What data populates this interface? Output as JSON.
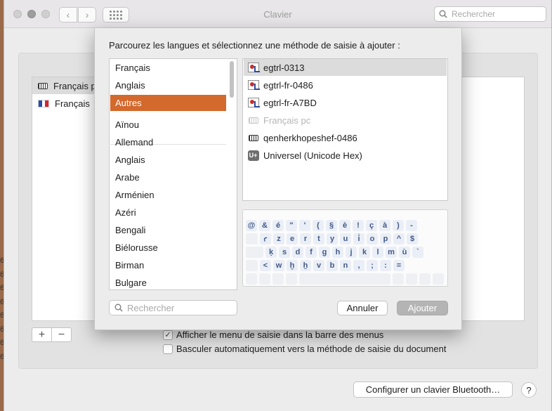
{
  "window": {
    "title": "Clavier",
    "search_placeholder": "Rechercher"
  },
  "edge_digits": [
    "6",
    "6",
    "6",
    "6",
    "6",
    "6",
    "6",
    "6"
  ],
  "input_sources": {
    "items": [
      {
        "label": "Français pc",
        "icon": "keyboard-icon"
      },
      {
        "label": "Français",
        "icon": "french-flag-icon"
      }
    ],
    "add_label": "+",
    "remove_label": "−"
  },
  "options": {
    "show_menu": {
      "label": "Afficher le menu de saisie dans la barre des menus",
      "checked": true
    },
    "auto_switch": {
      "label": "Basculer automatiquement vers la méthode de saisie du document",
      "checked": false
    }
  },
  "bluetooth_button": "Configurer un clavier Bluetooth…",
  "help_label": "?",
  "sheet": {
    "title": "Parcourez les langues et sélectionnez une méthode de saisie à ajouter :",
    "languages": [
      "Français",
      "Anglais",
      "Autres",
      "Aïnou",
      "Allemand",
      "Anglais",
      "Arabe",
      "Arménien",
      "Azéri",
      "Bengali",
      "Biélorusse",
      "Birman",
      "Bulgare"
    ],
    "selected_language": "Autres",
    "methods": [
      {
        "label": "egtrl-0313",
        "icon": "custom-layout-icon",
        "state": "selected"
      },
      {
        "label": "egtrl-fr-0486",
        "icon": "custom-layout-icon",
        "state": "normal"
      },
      {
        "label": "egtrl-fr-A7BD",
        "icon": "custom-layout-icon",
        "state": "normal"
      },
      {
        "label": "Français pc",
        "icon": "keyboard-icon",
        "state": "disabled"
      },
      {
        "label": "qenherkhopeshef-0486",
        "icon": "keyboard-icon",
        "state": "normal"
      },
      {
        "label": "Universel (Unicode Hex)",
        "icon": "unicode-hex-icon",
        "icon_text": "U+",
        "state": "normal"
      }
    ],
    "keyboard_rows": [
      [
        "@",
        "&",
        "é",
        "\"",
        "'",
        "(",
        "§",
        "è",
        "!",
        "ç",
        "à",
        ")",
        "-"
      ],
      [
        "",
        "ꜥ",
        "z",
        "e",
        "r",
        "t",
        "y",
        "u",
        "i͗",
        "o",
        "p",
        "^",
        "$"
      ],
      [
        "",
        "ḳ",
        "s",
        "d",
        "f",
        "g",
        "h",
        "j",
        "k",
        "l",
        "m",
        "ù",
        "`"
      ],
      [
        "",
        "<",
        "w",
        "ḫ",
        "ẖ",
        "v",
        "b",
        "n",
        ",",
        ";",
        ":",
        "="
      ]
    ],
    "search_placeholder": "Rechercher",
    "cancel_label": "Annuler",
    "add_label": "Ajouter"
  }
}
